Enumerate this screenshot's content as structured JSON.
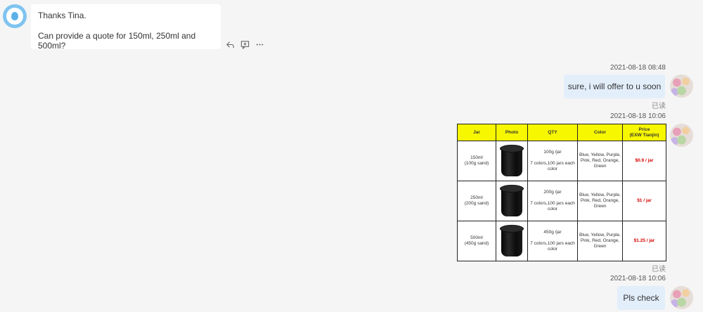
{
  "incoming": {
    "line1": "Thanks Tina.",
    "line2": "Can provide a quote for 150ml, 250ml and 500ml?",
    "actions": [
      "reply-icon",
      "quote-icon",
      "more-icon"
    ]
  },
  "messages": [
    {
      "timestamp": "2021-08-18 08:48",
      "text": "sure, i will offer to u soon",
      "read_status": "已读"
    },
    {
      "timestamp": "2021-08-18 10:06",
      "read_status": "已读"
    },
    {
      "timestamp": "2021-08-18 10:06",
      "text": "Pls check"
    }
  ],
  "quote_table": {
    "headers": [
      "Jar",
      "Photo",
      "QTY",
      "Color",
      "Price",
      "(EXW Tianjin)"
    ],
    "rows": [
      {
        "jar": "150ml",
        "jar_sub": "(100g sand)",
        "qty": "100g /jar",
        "qty_sub": "7 colors,100 jars each color",
        "color": "Blue, Yellow, Purple, Pink, Red, Orange, Green",
        "price": "$0.9 / jar"
      },
      {
        "jar": "250ml",
        "jar_sub": "(200g sand)",
        "qty": "200g /jar",
        "qty_sub": "7 colors,100 jars each color",
        "color": "Blue, Yellow, Purple, Pink, Red, Orange, Green",
        "price": "$1 / jar"
      },
      {
        "jar": "500ml",
        "jar_sub": "(450g sand)",
        "qty": "450g /jar",
        "qty_sub": "7 colors,100 jars each color",
        "color": "Blue, Yellow, Purple, Pink, Red, Orange, Green",
        "price": "$1.25 / jar"
      }
    ]
  },
  "colors": {
    "background": "#f5f5f5",
    "outgoing_bubble": "#e3eefb",
    "header_fill": "#f7f700",
    "price_text": "#d80000"
  }
}
